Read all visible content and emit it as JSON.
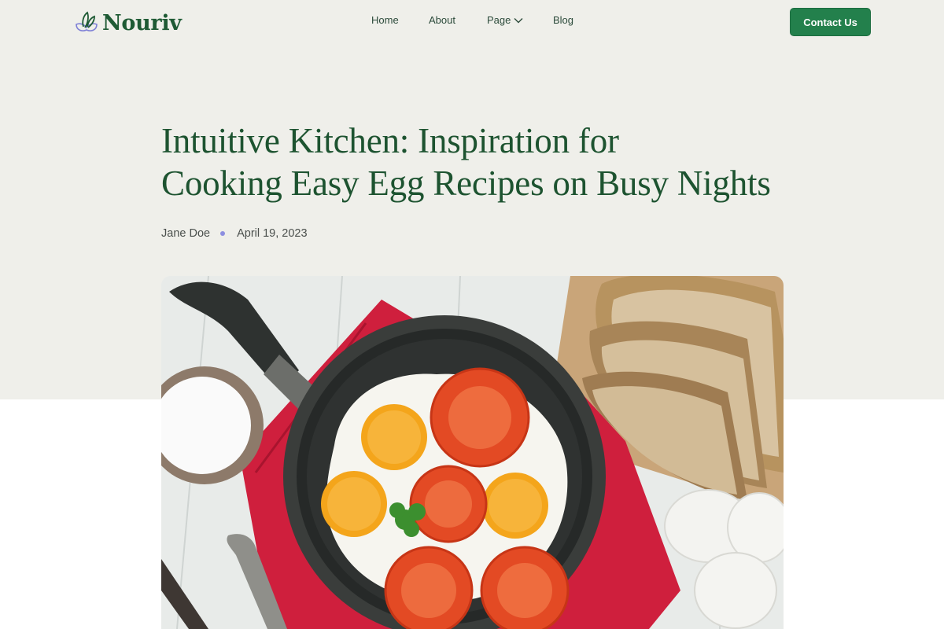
{
  "brand": {
    "name": "Nouriv"
  },
  "nav": {
    "home": "Home",
    "about": "About",
    "page": "Page",
    "blog": "Blog"
  },
  "header": {
    "contact_label": "Contact Us"
  },
  "article": {
    "title_line1": "Intuitive Kitchen: Inspiration for",
    "title_line2": "Cooking Easy Egg Recipes on Busy Nights",
    "author": "Jane Doe",
    "date": "April 19, 2023"
  },
  "colors": {
    "brand_green": "#1d5330",
    "button_green": "#23804c",
    "hero_background": "#efefea",
    "meta_dot": "#8d8fe0"
  },
  "icons": {
    "logo": "leaf-logo-icon",
    "dropdown": "chevron-down-icon"
  }
}
